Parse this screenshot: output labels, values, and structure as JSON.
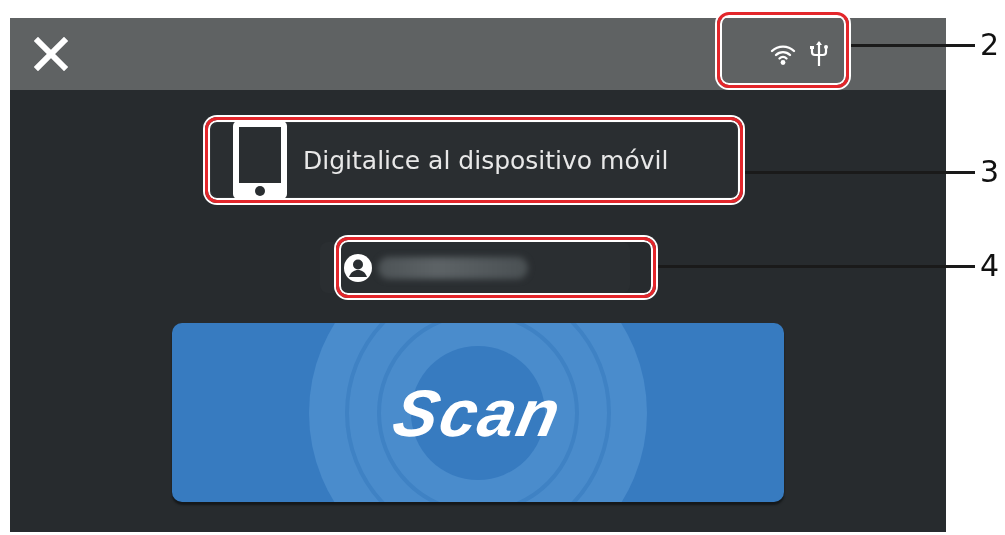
{
  "header": {
    "status_icons": [
      {
        "kind": "wifi"
      },
      {
        "kind": "usb"
      }
    ]
  },
  "mobile_button": {
    "label": "Digitalice al dispositivo móvil"
  },
  "user_button": {
    "name_blurred": true
  },
  "scan_button": {
    "label": "Scan"
  },
  "callouts": [
    {
      "number": "2"
    },
    {
      "number": "3"
    },
    {
      "number": "4"
    }
  ]
}
